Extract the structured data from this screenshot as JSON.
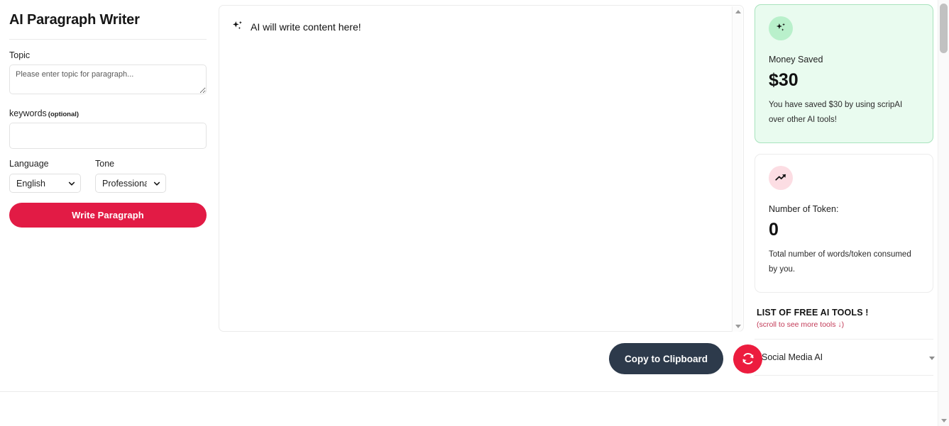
{
  "sidebar": {
    "app_title": "AI Paragraph Writer",
    "topic": {
      "label": "Topic",
      "placeholder": "Please enter topic for paragraph...",
      "value": ""
    },
    "keywords": {
      "label": "keywords",
      "optional_tag": "(optional)",
      "placeholder": "",
      "value": ""
    },
    "language": {
      "label": "Language",
      "selected": "English"
    },
    "tone": {
      "label": "Tone",
      "selected": "Professional"
    },
    "submit_label": "Write Paragraph",
    "accent_color": "#e21b45"
  },
  "content": {
    "placeholder_text": "AI will write content here!",
    "icon": "sparkle-icon",
    "value": ""
  },
  "actions": {
    "copy_label": "Copy to Clipboard",
    "copy_color": "#2d3a4b",
    "refresh_icon": "refresh-icon",
    "refresh_color": "#ec1c3e"
  },
  "right_panel": {
    "money_card": {
      "icon": "sparkle-icon",
      "icon_bg": "#b9f0cb",
      "card_bg": "#e9fbef",
      "card_border": "#a8e3bd",
      "title": "Money Saved",
      "value": "$30",
      "description": "You have saved $30 by using scripAI over other AI tools!"
    },
    "token_card": {
      "icon": "trending-up-icon",
      "icon_bg": "#fcdde3",
      "card_bg": "#ffffff",
      "card_border": "#ececec",
      "title": "Number of Token:",
      "value": "0",
      "description": "Total number of words/token consumed by you."
    },
    "tools": {
      "heading": "LIST OF FREE AI TOOLS !",
      "subheading": "(scroll to see more tools ↓)",
      "subheading_color": "#c23a57",
      "items": [
        {
          "label": "Social Media AI"
        }
      ]
    }
  }
}
